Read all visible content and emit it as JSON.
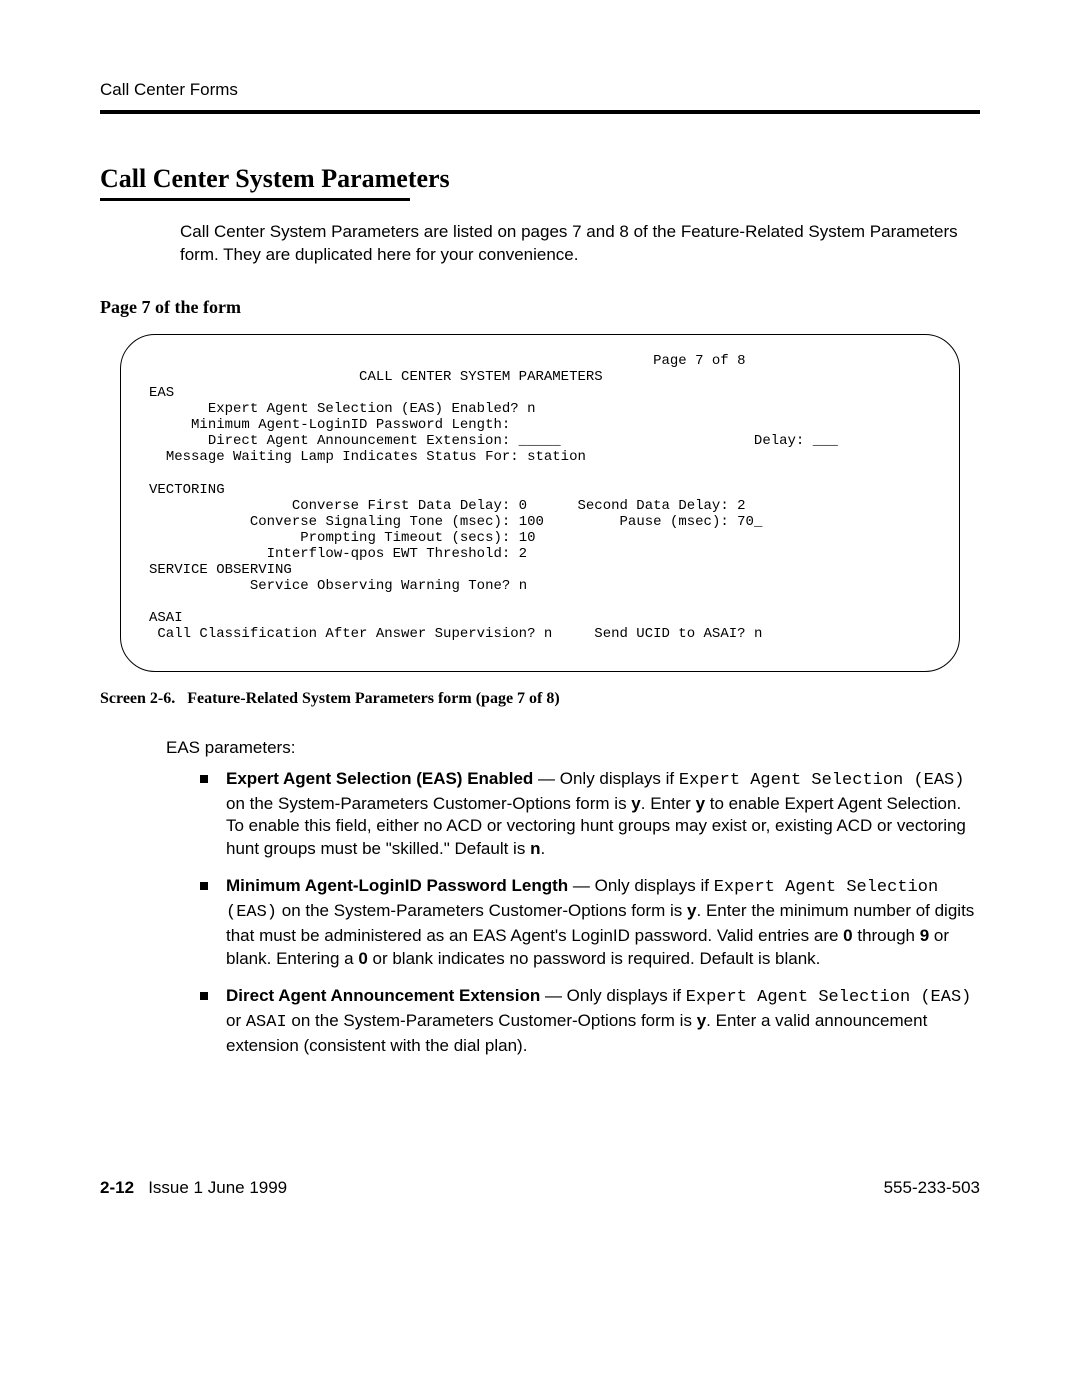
{
  "header": {
    "running": "Call Center Forms"
  },
  "section": {
    "title": "Call Center System Parameters",
    "intro": "Call Center System Parameters are listed on pages 7 and 8 of the Feature-Related System Parameters form. They are duplicated here for your convenience.",
    "subheading": "Page 7 of the form"
  },
  "screen": {
    "page_indicator": "Page 7 of 8",
    "title": "CALL CENTER SYSTEM PARAMETERS",
    "eas_header": "EAS",
    "eas": {
      "expert_label": "Expert Agent Selection (EAS) Enabled?",
      "expert_value": "n",
      "min_pw_label": "Minimum Agent-LoginID Password Length:",
      "min_pw_value": "",
      "daae_label": "Direct Agent Announcement Extension:",
      "daae_value": "_____",
      "delay_label": "Delay:",
      "delay_value": "___",
      "mwl_label": "Message Waiting Lamp Indicates Status For:",
      "mwl_value": "station"
    },
    "vectoring_header": "VECTORING",
    "vectoring": {
      "cfdd_label": "Converse First Data Delay:",
      "cfdd_value": "0",
      "sdd_label": "Second Data Delay:",
      "sdd_value": "2",
      "cst_label": "Converse Signaling Tone (msec):",
      "cst_value": "100",
      "pause_label": "Pause (msec):",
      "pause_value": "70_",
      "prompt_label": "Prompting Timeout (secs):",
      "prompt_value": "10",
      "iqewt_label": "Interflow-qpos EWT Threshold:",
      "iqewt_value": "2"
    },
    "service_header": "SERVICE OBSERVING",
    "service": {
      "sowt_label": "Service Observing Warning Tone?",
      "sowt_value": "n"
    },
    "asai_header": "ASAI",
    "asai": {
      "ccaas_label": "Call Classification After Answer Supervision?",
      "ccaas_value": "n",
      "sucid_label": "Send UCID to ASAI?",
      "sucid_value": "n"
    }
  },
  "caption": {
    "prefix": "Screen 2-6.",
    "text": "Feature-Related System Parameters form (page 7 of 8)"
  },
  "eas_params_label": "EAS parameters:",
  "bullets": {
    "b1": {
      "title": "Expert Agent Selection (EAS) Enabled",
      "lead": " — Only displays if ",
      "mono": "Expert Agent Selection (EAS)",
      "tail_a": " on the System-Parameters Customer-Options form is ",
      "y1": "y",
      "tail_b": ". Enter ",
      "y2": "y",
      "tail_c": " to enable Expert Agent Selection. To enable this field, either no ACD or vectoring hunt groups may exist or, existing ACD or vectoring hunt groups must be \"skilled.\" Default is ",
      "n": "n",
      "tail_d": "."
    },
    "b2": {
      "title": "Minimum Agent-LoginID Password Length",
      "lead": " — Only displays if ",
      "mono": "Expert Agent Selection (EAS)",
      "tail_a": " on the System-Parameters Customer-Options form is ",
      "y": "y",
      "tail_b": ". Enter the minimum number of digits that must be administered as an EAS Agent's LoginID password. Valid entries are ",
      "z0": "0",
      "tail_c": " through ",
      "z9": "9",
      "tail_d": " or blank. Entering a ",
      "z0b": "0",
      "tail_e": " or blank indicates no password is required. Default is blank."
    },
    "b3": {
      "title": "Direct Agent Announcement Extension",
      "lead": " — Only displays if ",
      "mono": "Expert Agent Selection (EAS)",
      "or": " or ",
      "mono2": "ASAI",
      "tail_a": " on the System-Parameters Customer-Options form is ",
      "y": "y",
      "tail_b": ". Enter a valid announcement extension (consistent with the dial plan)."
    }
  },
  "footer": {
    "pageno": "2-12",
    "issue": "Issue 1 June 1999",
    "docnum": "555-233-503"
  }
}
